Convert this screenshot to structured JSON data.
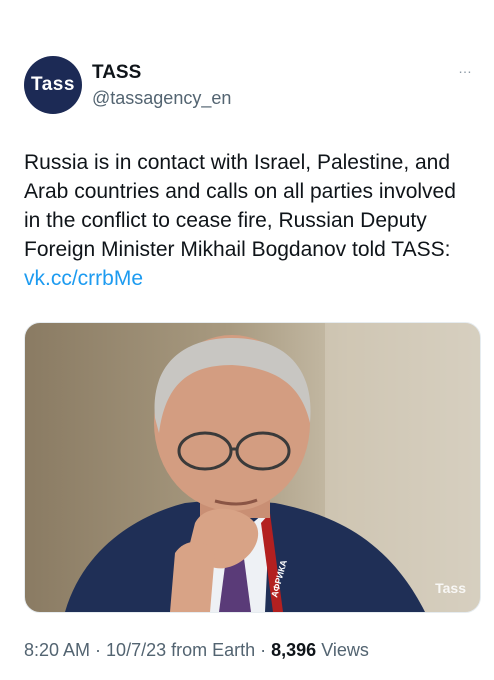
{
  "author": {
    "avatar_text": "Tass",
    "name": "TASS",
    "handle": "@tassagency_en",
    "more_icon": "…"
  },
  "tweet": {
    "text": "Russia is in contact with Israel, Palestine, and Arab countries and calls on all parties involved in the conflict to cease fire, Russian Deputy Foreign Minister Mikhail Bogdanov told TASS:",
    "link": "vk.cc/crrbMe"
  },
  "media": {
    "watermark": "Tass",
    "badge_text": "АФРИКА"
  },
  "meta": {
    "time": "8:20 AM",
    "sep1": " · ",
    "date": "10/7/23",
    "source": " from Earth",
    "sep2": " · ",
    "views_count": "8,396",
    "views_label": " Views"
  }
}
